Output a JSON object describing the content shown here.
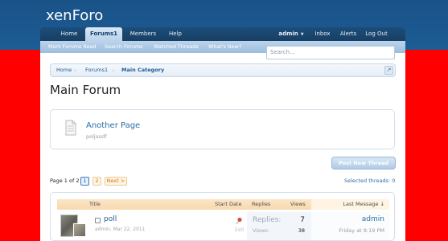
{
  "header": {
    "logo_text": "xenForo"
  },
  "nav": {
    "tabs": [
      {
        "label": "Home"
      },
      {
        "label": "Forums1"
      },
      {
        "label": "Members"
      },
      {
        "label": "Help"
      }
    ],
    "user": {
      "label": "admin"
    },
    "right_links": [
      {
        "label": "Inbox"
      },
      {
        "label": "Alerts"
      },
      {
        "label": "Log Out"
      }
    ]
  },
  "subnav": {
    "links": [
      {
        "label": "Mark Forums Read"
      },
      {
        "label": "Search Forums"
      },
      {
        "label": "Watched Threads"
      },
      {
        "label": "What's New?"
      }
    ]
  },
  "search": {
    "placeholder": "Search..."
  },
  "breadcrumb": {
    "items": [
      {
        "label": "Home"
      },
      {
        "label": "Forums1"
      },
      {
        "label": "Main Category"
      }
    ]
  },
  "page": {
    "title": "Main Forum"
  },
  "node": {
    "title": "Another Page",
    "description": "poljasdf"
  },
  "post_button": {
    "label": "Post New Thread"
  },
  "pagination": {
    "label": "Page 1 of 2",
    "pages": [
      "1",
      "2"
    ],
    "next_label": "Next >"
  },
  "selected_threads": {
    "label": "Selected threads: 0"
  },
  "thread_table": {
    "headers": {
      "title": "Title",
      "start_date": "Start Date",
      "replies": "Replies",
      "views": "Views",
      "last_message": "Last Message ↓"
    },
    "rows": [
      {
        "title": "poll",
        "meta": "admin, Mar 22, 2011",
        "edit_label": "Edit",
        "replies_label": "Replies:",
        "views_label": "Views:",
        "replies": "7",
        "views": "38",
        "last_user": "admin",
        "last_date": "Friday at 9:19 PM"
      }
    ]
  },
  "colors": {
    "header": "#195287",
    "link": "#1d5c95",
    "page_background": "#ff0000"
  }
}
